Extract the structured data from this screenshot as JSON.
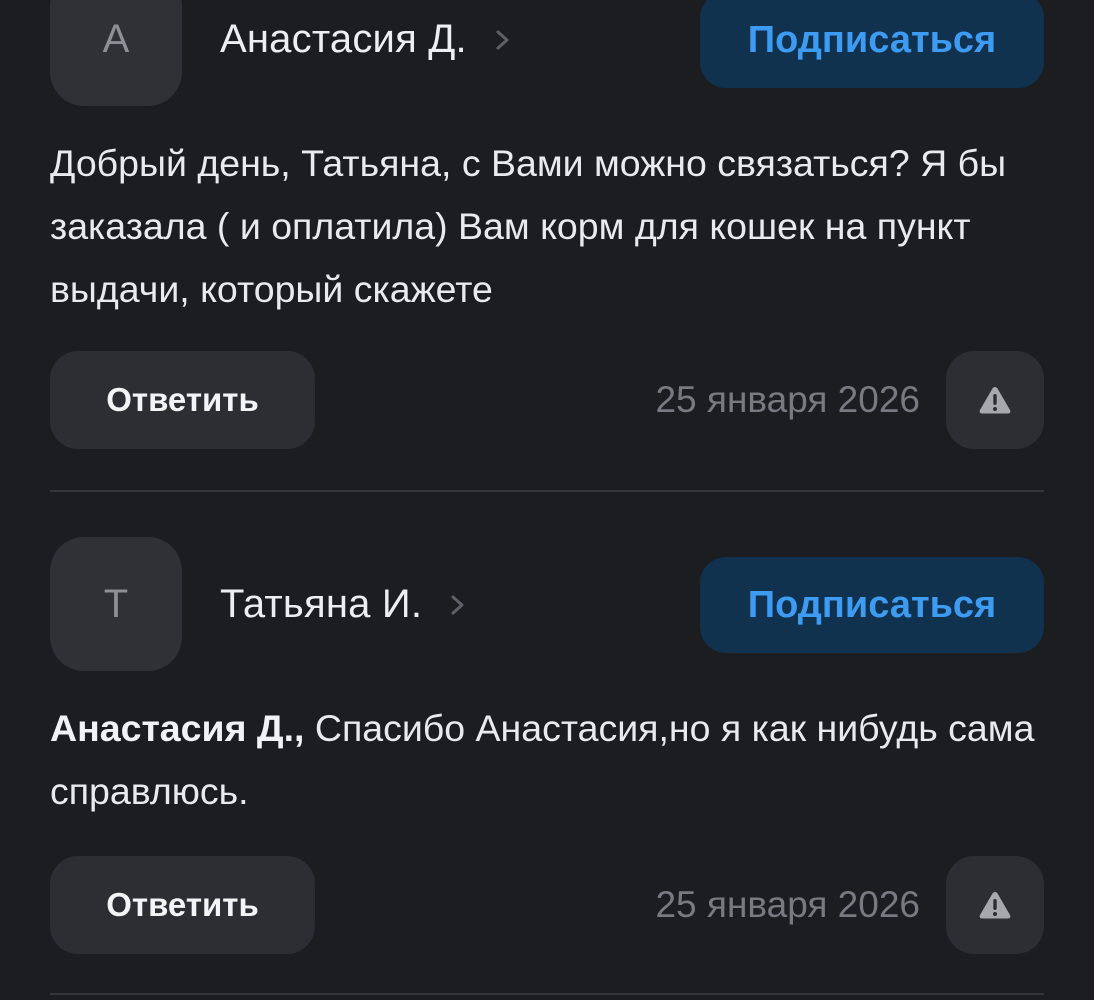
{
  "comments": [
    {
      "avatar_letter": "А",
      "author": "Анастасия Д.",
      "follow_label": "Подписаться",
      "mention": "",
      "text": "Добрый день, Татьяна, с Вами можно связаться? Я бы заказала ( и оплатила) Вам корм для кошек на пункт выдачи, который скажете",
      "reply_label": "Ответить",
      "date": "25 января 2026"
    },
    {
      "avatar_letter": "Т",
      "author": "Татьяна И.",
      "follow_label": "Подписаться",
      "mention": "Анастасия Д.,",
      "text": " Спасибо Анастасия,но я как нибудь сама справлюсь.",
      "reply_label": "Ответить",
      "date": "25 января 2026"
    }
  ],
  "icons": {
    "chevron": "chevron-right-icon",
    "report": "warning-icon"
  },
  "colors": {
    "background": "#1b1d21",
    "follow_bg": "#11324f",
    "follow_text": "#3d9bf2",
    "button_bg": "#2c2e33"
  }
}
